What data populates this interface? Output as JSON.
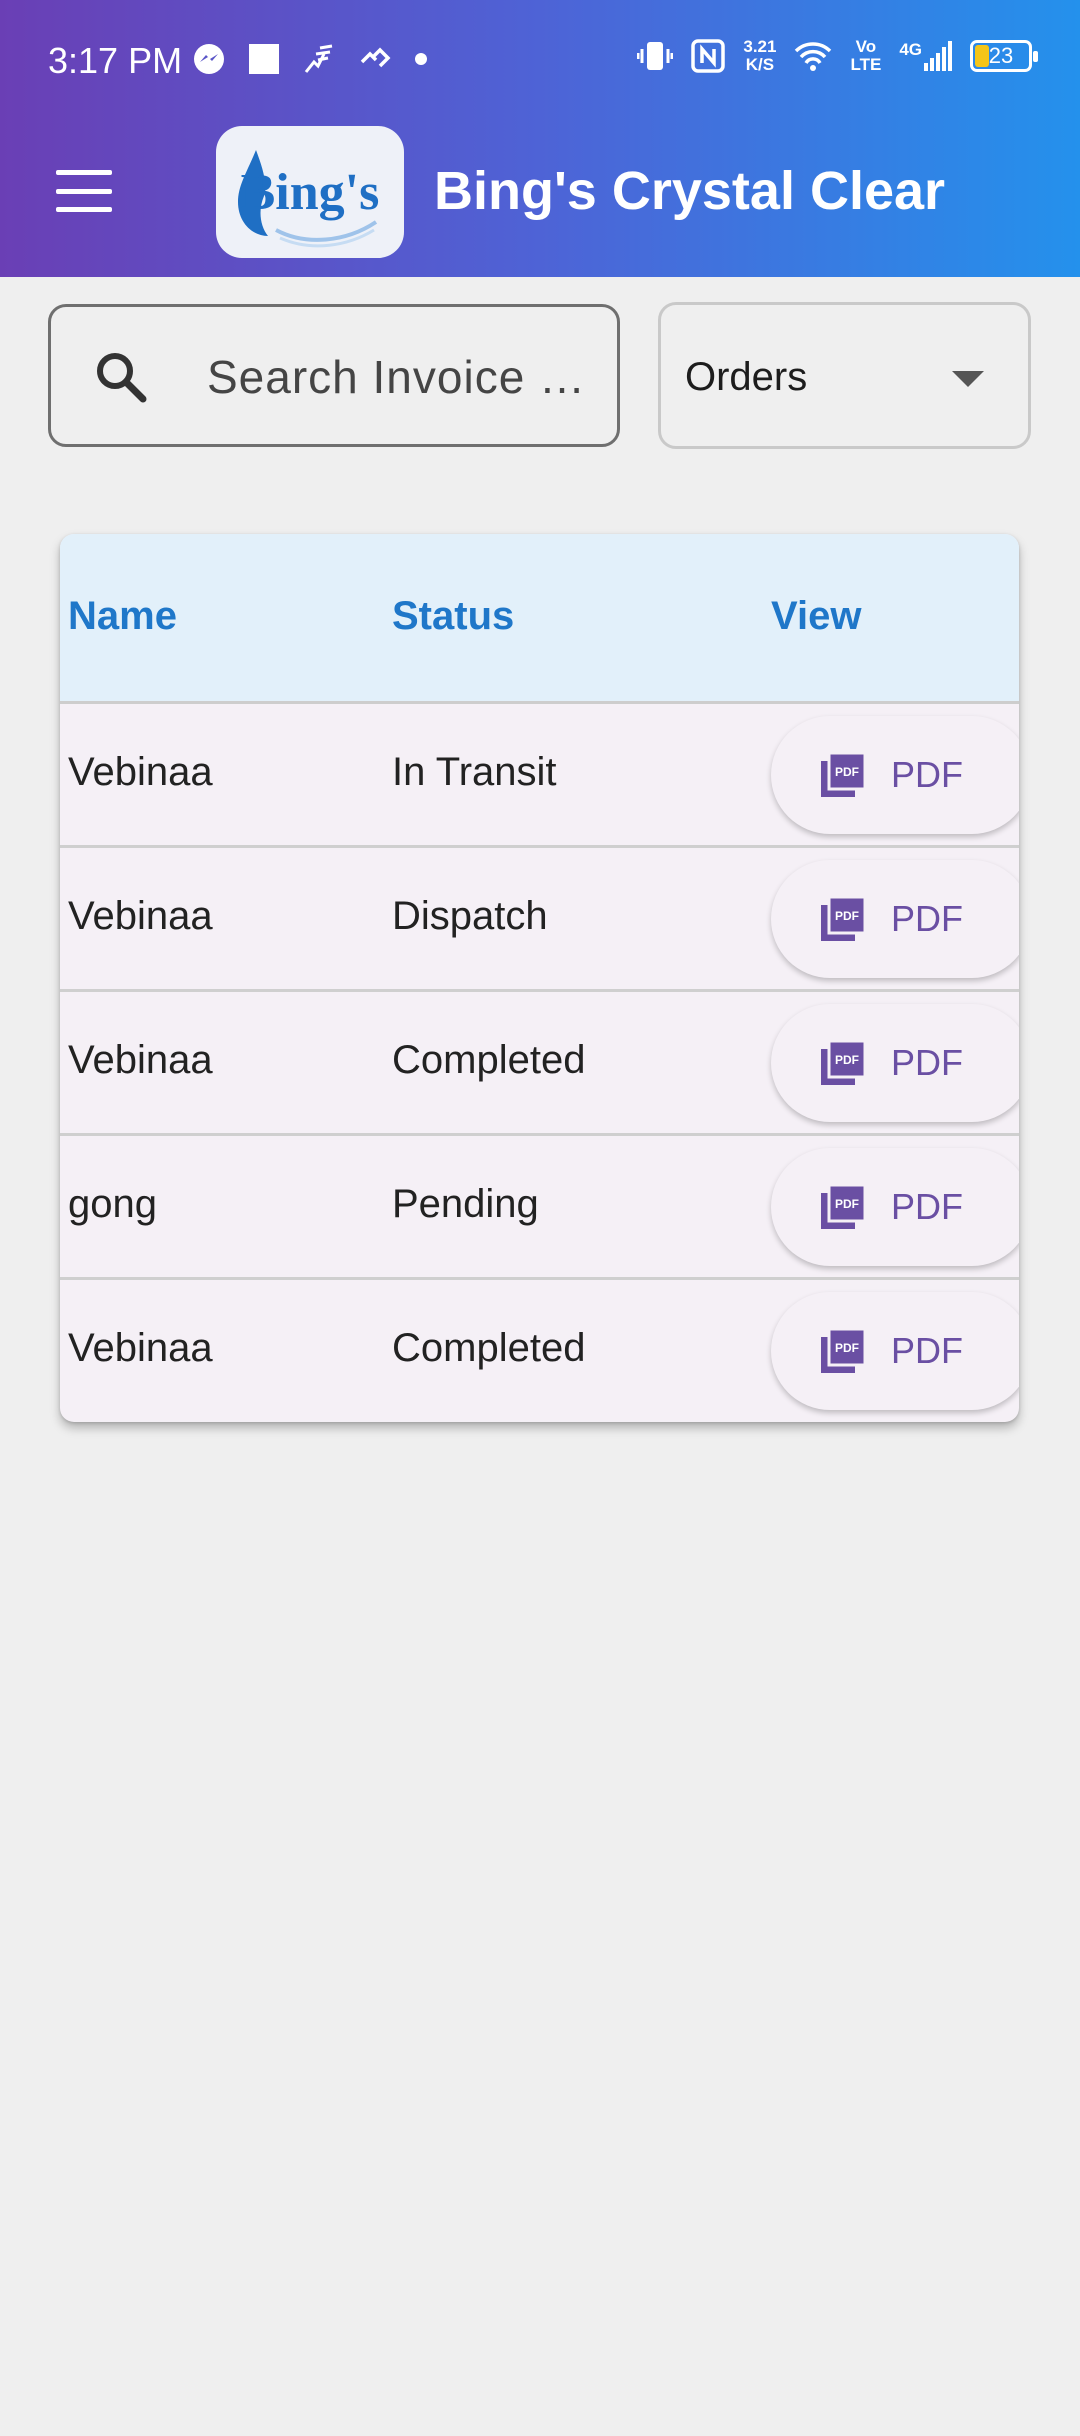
{
  "status_bar": {
    "time": "3:17 PM",
    "net_speed_value": "3.21",
    "net_speed_unit": "K/S",
    "volte_top": "Vo",
    "volte_bottom": "LTE",
    "network": "4G",
    "battery": "23",
    "left_icons": [
      "messenger-icon",
      "square-icon",
      "fitness-icon",
      "link-icon",
      "dot-icon"
    ],
    "right_icons": [
      "vibrate-icon",
      "nfc-icon",
      "wifi-icon",
      "signal-icon",
      "battery-icon"
    ]
  },
  "header": {
    "logo_text": "Bing's",
    "title": "Bing's Crystal Clear",
    "brand_gradient": [
      "#6a3fb5",
      "#2491ec"
    ]
  },
  "search": {
    "placeholder": "Search Invoice …"
  },
  "filter": {
    "selected": "Orders"
  },
  "table": {
    "columns": [
      "Name",
      "Status",
      "View"
    ],
    "rows": [
      {
        "name": "Vebinaa",
        "status": "In Transit",
        "view_label": "PDF"
      },
      {
        "name": "Vebinaa",
        "status": "Dispatch",
        "view_label": "PDF"
      },
      {
        "name": "Vebinaa",
        "status": "Completed",
        "view_label": "PDF"
      },
      {
        "name": "gong",
        "status": "Pending",
        "view_label": "PDF"
      },
      {
        "name": "Vebinaa",
        "status": "Completed",
        "view_label": "PDF"
      }
    ],
    "header_color": "#1f77c9",
    "button_color": "#6a4fa3"
  }
}
